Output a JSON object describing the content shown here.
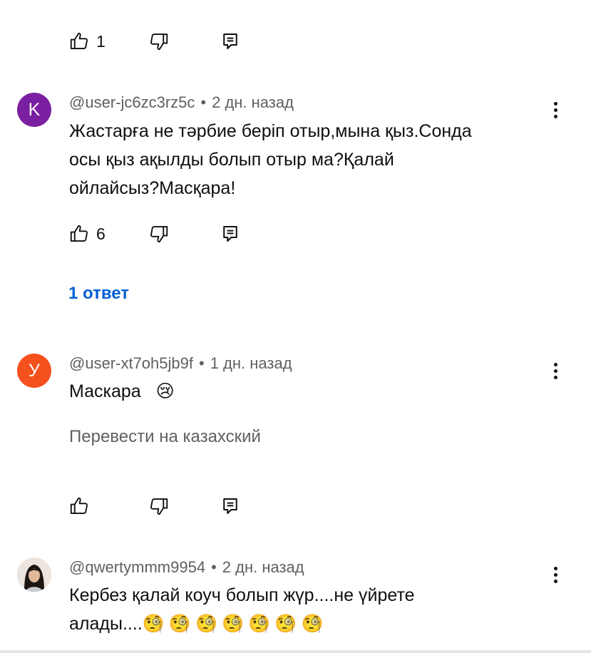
{
  "first_actions": {
    "like_count": "1"
  },
  "comments": [
    {
      "avatar_letter": "K",
      "avatar_color": "#7b1fa2",
      "author": "@user-jc6zc3rz5c",
      "separator": "•",
      "time": "2 дн. назад",
      "lines": [
        "Жастарға не тәрбие беріп отыр,мына қыз.Сонда",
        "осы қыз ақылды болып отыр ма?Қалай",
        "ойлайсыз?Масқара!"
      ],
      "like_count": "6",
      "replies_label": "1 ответ"
    },
    {
      "avatar_letter": "У",
      "avatar_color": "#f4511e",
      "author": "@user-xt7oh5jb9f",
      "separator": "•",
      "time": "1 дн. назад",
      "text": "Маскара",
      "emoji": "😢",
      "translate_label": "Перевести на казахский",
      "like_count": ""
    },
    {
      "avatar_icon": "user-photo-avatar",
      "author": "@qwertymmm9954",
      "separator": "•",
      "time": "2 дн. назад",
      "line1": "Кербез қалай коуч  болып жүр....не үйрете",
      "line2": "алады....",
      "emojis": "🧐🧐🧐🧐🧐🧐🧐"
    }
  ],
  "icons": {
    "like": "thumbs-up-icon",
    "dislike": "thumbs-down-icon",
    "reply": "comment-reply-icon",
    "menu": "more-vertical-icon"
  },
  "colors": {
    "link": "#065fd4",
    "secondary_text": "#606060"
  }
}
